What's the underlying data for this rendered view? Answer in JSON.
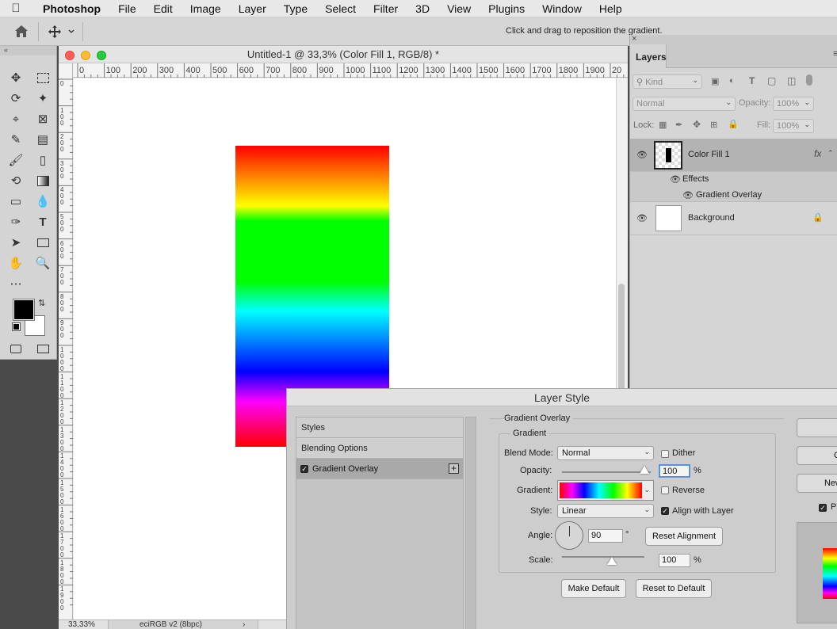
{
  "menubar": {
    "app": "Photoshop",
    "items": [
      "File",
      "Edit",
      "Image",
      "Layer",
      "Type",
      "Select",
      "Filter",
      "3D",
      "View",
      "Plugins",
      "Window",
      "Help"
    ]
  },
  "optionsbar": {
    "hint": "Click and drag to reposition the gradient."
  },
  "document": {
    "title": "Untitled-1 @ 33,3% (Color Fill 1, RGB/8) *",
    "zoom": "33,33%",
    "profile": "eciRGB v2 (8bpc)",
    "ruler_h": [
      "0",
      "100",
      "200",
      "300",
      "400",
      "500",
      "600",
      "700",
      "800",
      "900",
      "1000",
      "1100",
      "1200",
      "1300",
      "1400",
      "1500",
      "1600",
      "1700",
      "1800",
      "1900",
      "20"
    ],
    "ruler_v": [
      "0",
      "100",
      "200",
      "300",
      "400",
      "500",
      "600",
      "700",
      "800",
      "900",
      "1000",
      "1100",
      "1200",
      "1300",
      "1400",
      "1500",
      "1600",
      "1700",
      "1800",
      "1900"
    ],
    "gradient_colors": [
      "#ff0000",
      "#ffff00",
      "#00ff00",
      "#00ffff",
      "#0000ff",
      "#ff00ff",
      "#ff0000"
    ]
  },
  "layers_panel": {
    "tab": "Layers",
    "kind_placeholder": "Kind",
    "blend_mode": "Normal",
    "opacity_label": "Opacity:",
    "opacity_value": "100%",
    "lock_label": "Lock:",
    "fill_label": "Fill:",
    "fill_value": "100%",
    "layers": [
      {
        "name": "Color Fill 1",
        "fx": "fx",
        "effects_label": "Effects",
        "effect": "Gradient Overlay"
      },
      {
        "name": "Background"
      }
    ]
  },
  "layer_style": {
    "title": "Layer Style",
    "styles": [
      "Styles",
      "Blending Options",
      "Gradient Overlay"
    ],
    "section": "Gradient Overlay",
    "subsection": "Gradient",
    "blend_mode_label": "Blend Mode:",
    "blend_mode": "Normal",
    "dither_label": "Dither",
    "opacity_label": "Opacity:",
    "opacity": "100",
    "pct": "%",
    "gradient_label": "Gradient:",
    "reverse_label": "Reverse",
    "style_label": "Style:",
    "style": "Linear",
    "align_label": "Align with Layer",
    "angle_label": "Angle:",
    "angle": "90",
    "deg": "°",
    "reset_alignment": "Reset Alignment",
    "scale_label": "Scale:",
    "scale": "100",
    "make_default": "Make Default",
    "reset_default": "Reset to Default",
    "side_buttons": [
      "C",
      "New"
    ],
    "preview_label": "P"
  }
}
